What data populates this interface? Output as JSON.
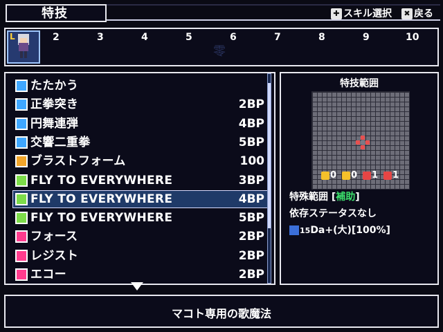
{
  "header": {
    "title": "特技",
    "hints": [
      {
        "icon": "dpad-icon",
        "label": "スキル選択"
      },
      {
        "icon": "x-button-icon",
        "label": "戻る"
      }
    ]
  },
  "party": {
    "leader_marker": "L",
    "slots": [
      "2",
      "3",
      "4",
      "5",
      "6",
      "7",
      "8",
      "9",
      "10"
    ],
    "faded_glyph": "零"
  },
  "skills": [
    {
      "name": "たたかう",
      "cost": "",
      "icon": "attack-icon",
      "icon_color": "#3fa7ff"
    },
    {
      "name": "正拳突き",
      "cost": "2BP",
      "icon": "skill-icon",
      "icon_color": "#3fa7ff"
    },
    {
      "name": "円舞連弾",
      "cost": "4BP",
      "icon": "skill-icon",
      "icon_color": "#3fa7ff"
    },
    {
      "name": "交響二重拳",
      "cost": "5BP",
      "icon": "skill-icon",
      "icon_color": "#3fa7ff"
    },
    {
      "name": "ブラストフォーム",
      "cost": "100",
      "icon": "special-icon",
      "icon_color": "#f2a52b"
    },
    {
      "name": "FLY TO EVERYWHERE",
      "cost": "3BP",
      "icon": "song-icon",
      "icon_color": "#7ddc4a"
    },
    {
      "name": "FLY TO EVERYWHERE",
      "cost": "4BP",
      "icon": "song-plus-icon",
      "icon_color": "#7ddc4a"
    },
    {
      "name": "FLY TO EVERYWHERE",
      "cost": "5BP",
      "icon": "song-plus2-icon",
      "icon_color": "#7ddc4a"
    },
    {
      "name": "フォース",
      "cost": "2BP",
      "icon": "vo-icon",
      "icon_color": "#ff3c8e"
    },
    {
      "name": "レジスト",
      "cost": "2BP",
      "icon": "vo-icon",
      "icon_color": "#ff3c8e"
    },
    {
      "name": "エコー",
      "cost": "2BP",
      "icon": "vo-icon",
      "icon_color": "#ff3c8e"
    }
  ],
  "selected_index": 6,
  "range": {
    "title": "特技範囲",
    "stats": [
      {
        "value": "0",
        "icon": "up-arrow-yellow-icon"
      },
      {
        "value": "0",
        "icon": "down-arrow-yellow-icon"
      },
      {
        "value": "1",
        "icon": "up-arrow-red-icon"
      },
      {
        "value": "1",
        "icon": "down-arrow-red-icon"
      }
    ],
    "special_label": "特殊範囲 [",
    "special_value": "補助",
    "special_close": "]",
    "dependency": "依存ステータスなし",
    "effect_level": "15",
    "effect": "Da+(大)[100%]"
  },
  "description": "マコト専用の歌魔法"
}
